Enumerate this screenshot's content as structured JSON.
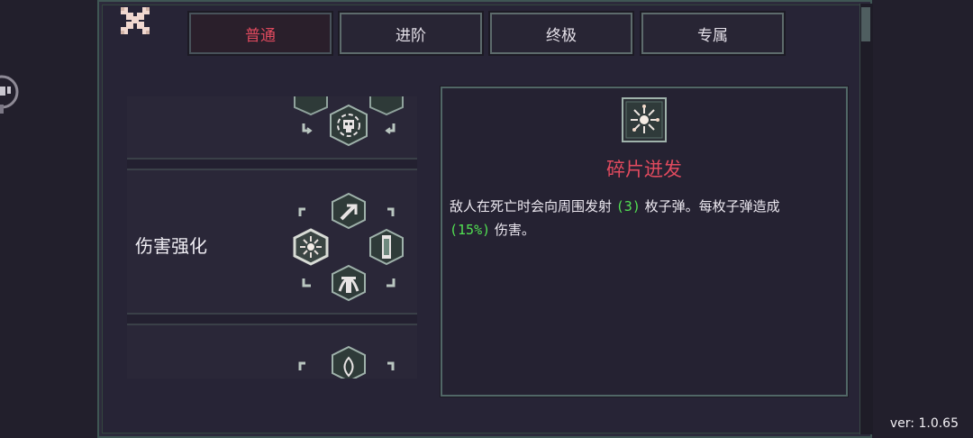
{
  "tabs": [
    {
      "label": "普通",
      "active": true
    },
    {
      "label": "进阶",
      "active": false
    },
    {
      "label": "终极",
      "active": false
    },
    {
      "label": "专属",
      "active": false
    }
  ],
  "list": {
    "items": [
      {
        "title": ""
      },
      {
        "title": "伤害强化"
      },
      {
        "title": ""
      }
    ]
  },
  "detail": {
    "title": "碎片迸发",
    "desc_part1": "敌人在死亡时会向周围发射 ",
    "count": "(3)",
    "desc_part2": " 枚子弹。每枚子弹造成",
    "percent": "(15%)",
    "desc_part3": " 伤害。"
  },
  "version": "ver: 1.0.65",
  "colors": {
    "accent_red": "#e04a5e",
    "highlight_green": "#52e052",
    "border_teal": "#516767",
    "panel_bg": "#272436"
  },
  "icons": [
    "close-icon",
    "skull-target-icon",
    "arrow-up-icon",
    "burst-icon",
    "pillar-icon",
    "fountain-icon",
    "shard-burst-icon",
    "flame-icon"
  ]
}
